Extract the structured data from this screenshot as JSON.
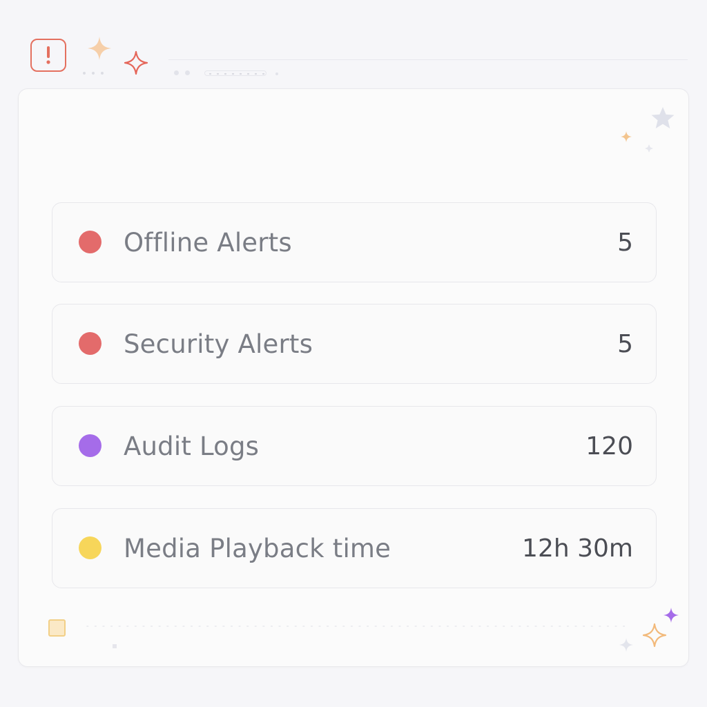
{
  "header": {
    "alert_icon": "exclamation-alert-icon",
    "alert_color": "#e4705f"
  },
  "stats": [
    {
      "label": "Offline Alerts",
      "value": "5",
      "color": "#e36b6b"
    },
    {
      "label": "Security Alerts",
      "value": "5",
      "color": "#e36b6b"
    },
    {
      "label": "Audit Logs",
      "value": "120",
      "color": "#a56ce9"
    },
    {
      "label": "Media Playback time",
      "value": "12h 30m",
      "color": "#f7d65a"
    }
  ]
}
